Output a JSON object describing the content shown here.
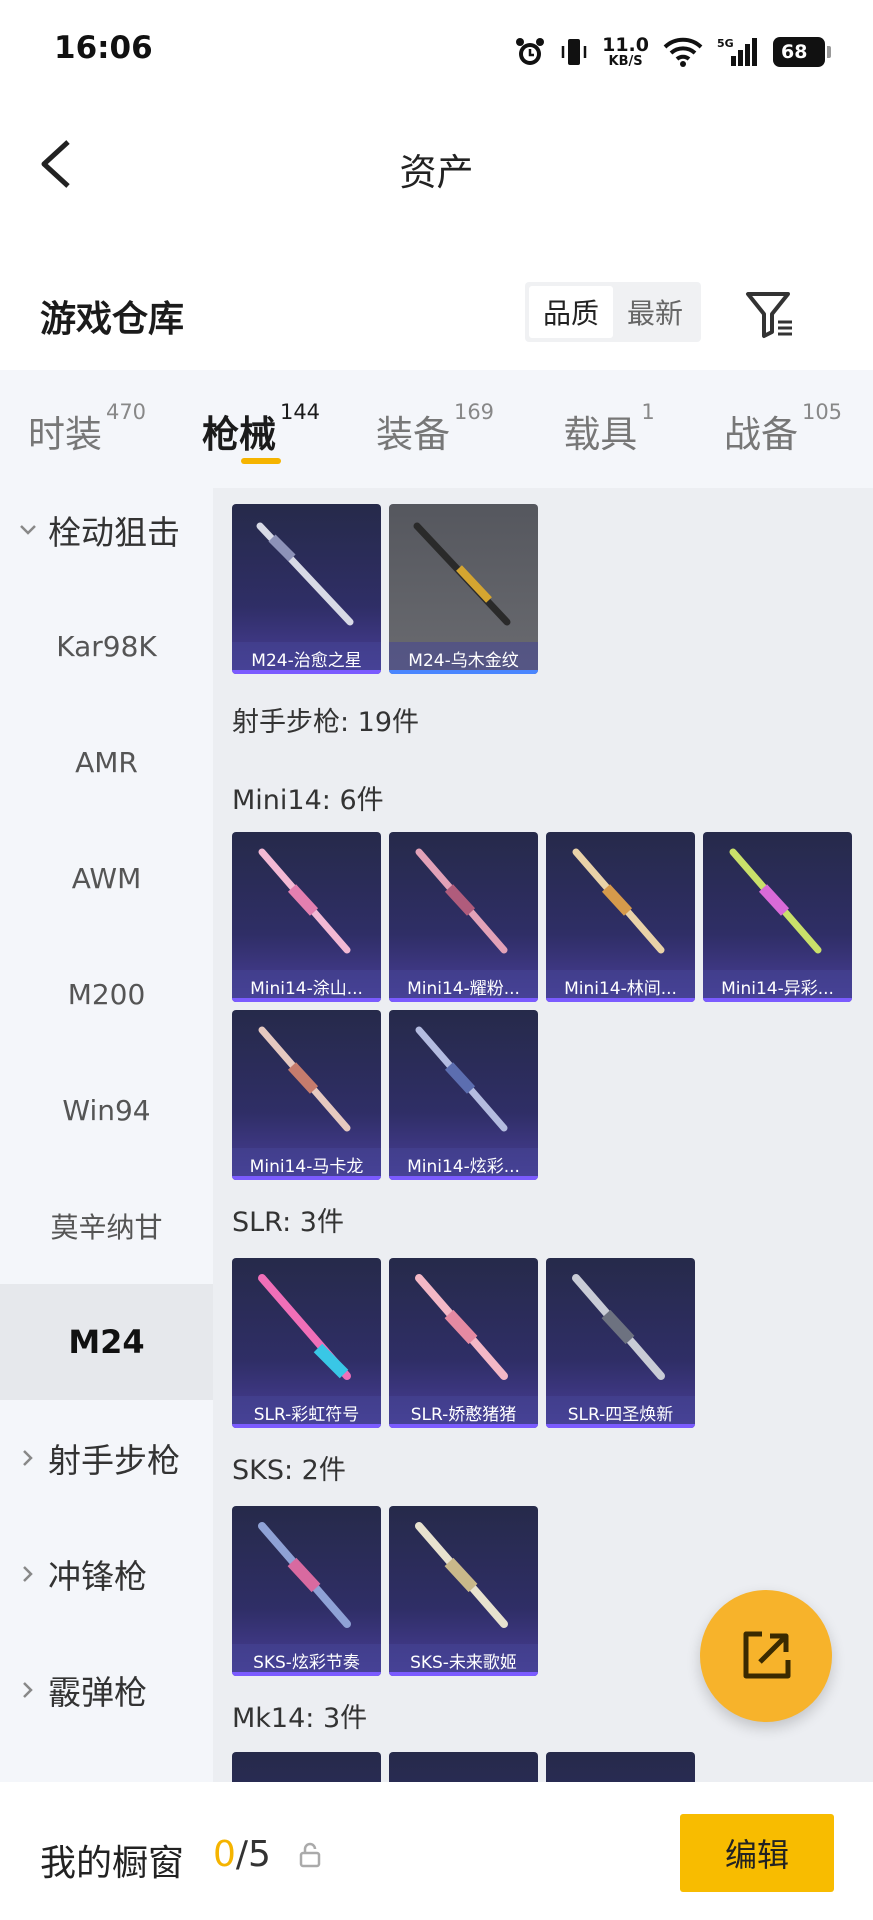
{
  "status": {
    "time": "16:06",
    "speed_value": "11.0",
    "speed_unit": "KB/S",
    "network": "5G",
    "battery": "68"
  },
  "nav": {
    "title": "资产"
  },
  "section": {
    "title": "游戏仓库",
    "sort_options": [
      "品质",
      "最新"
    ]
  },
  "tabs": [
    {
      "label": "时装",
      "count": "470"
    },
    {
      "label": "枪械",
      "count": "144"
    },
    {
      "label": "装备",
      "count": "169"
    },
    {
      "label": "载具",
      "count": "1"
    },
    {
      "label": "战备",
      "count": "105"
    }
  ],
  "sidebar": {
    "group_bolt": "栓动狙击",
    "items": [
      "Kar98K",
      "AMR",
      "AWM",
      "M200",
      "Win94",
      "莫辛纳甘",
      "M24"
    ],
    "group_marksman": "射手步枪",
    "group_smg": "冲锋枪",
    "group_shotgun": "霰弹枪"
  },
  "content": {
    "m24": [
      "M24-治愈之星",
      "M24-乌木金纹"
    ],
    "marksman_heading": "射手步枪: 19件",
    "mini14_heading": "Mini14: 6件",
    "mini14": [
      "Mini14-涂山...",
      "Mini14-耀粉...",
      "Mini14-林间...",
      "Mini14-异彩...",
      "Mini14-马卡龙",
      "Mini14-炫彩..."
    ],
    "slr_heading": "SLR: 3件",
    "slr": [
      "SLR-彩虹符号",
      "SLR-娇憨猪猪",
      "SLR-四圣焕新"
    ],
    "sks_heading": "SKS: 2件",
    "sks": [
      "SKS-炫彩节奏",
      "SKS-未来歌姬"
    ],
    "mk14_heading": "Mk14: 3件"
  },
  "bottom": {
    "label": "我的橱窗",
    "current": "0",
    "total": "/5",
    "edit": "编辑"
  },
  "colors": {
    "accent": "#f5b400",
    "card_bg": "#2f2e66",
    "fab": "#f7b32b"
  }
}
